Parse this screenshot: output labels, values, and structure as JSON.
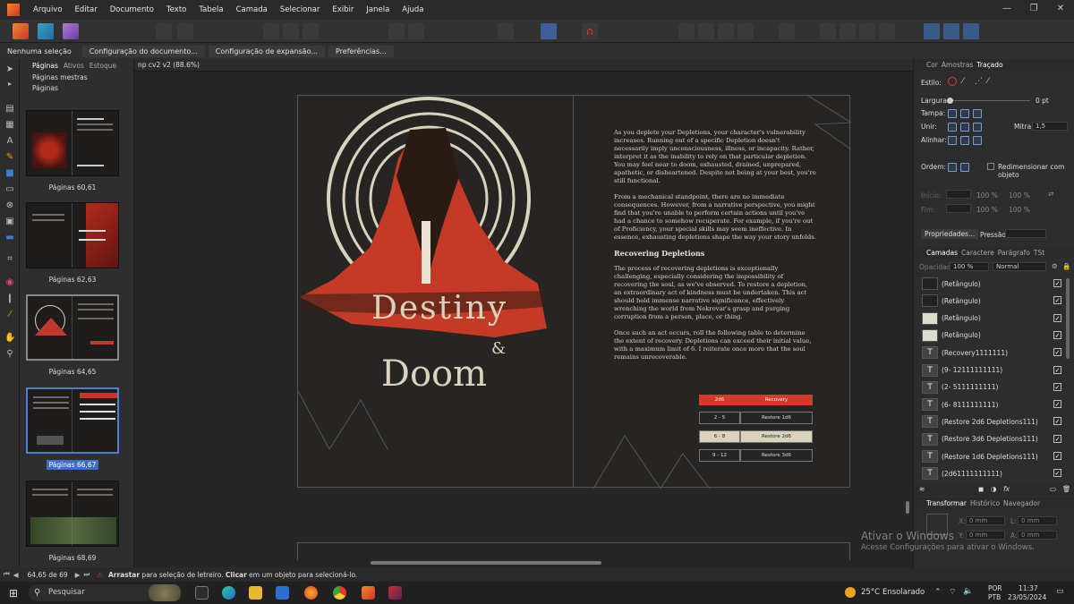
{
  "menu": [
    "Arquivo",
    "Editar",
    "Documento",
    "Texto",
    "Tabela",
    "Camada",
    "Selecionar",
    "Exibir",
    "Janela",
    "Ajuda"
  ],
  "context_bar": {
    "selection": "Nenhuma seleção",
    "doc_setup": "Configuração do documento...",
    "bleed_setup": "Configuração de expansão...",
    "preferences": "Preferências..."
  },
  "pages_panel": {
    "tabs": [
      "Páginas",
      "Ativos",
      "Estoque"
    ],
    "master_pages": "Páginas mestras",
    "pages": "Páginas",
    "thumbnails": [
      {
        "label": "Páginas 60,61"
      },
      {
        "label": "Páginas 62,63"
      },
      {
        "label": "Páginas 64,65"
      },
      {
        "label": "Páginas 66,67"
      },
      {
        "label": "Páginas 68,69"
      }
    ]
  },
  "document": {
    "tab": "np cv2 v2 (88.6%)",
    "title_word1": "Destiny",
    "title_amp": "&",
    "title_word2": "Doom",
    "paragraphs": [
      "As you deplete your Depletions, your character's vulnerability increases. Running out of a specific Depletion doesn't necessarily imply unconsciousness, illness, or incapacity. Rather, interpret it as the inability to rely on that particular depletion. You may feel near to doom, exhausted, drained, unprepared, apathetic, or disheartened. Despite not being at your best, you're still functional.",
      "From a mechanical standpoint, there are no immediate consequences. However, from a narrative perspective, you might find that you're unable to perform certain actions until you've had a chance to somehow recuperate. For example, if you're out of Proficiency, your special skills may seem ineffective. In essence, exhausting depletions shape the way your story unfolds.",
      "The process of recovering depletions is exceptionally challenging, especially considering the impossibility of recovering the soul, as we've observed. To restore a depletion, an extraordinary act of kindness must be undertaken. This act should hold immense narrative significance, effectively wrenching the world from Nekrovar's grasp and purging corruption from a person, place, or thing.",
      "Once such an act occurs, roll the following table to determine the extent of recovery. Depletions can exceed their initial value, with a maximum limit of 6. I reiterate once more that the soul remains unrecoverable."
    ],
    "heading": "Recovering Depletions",
    "table": {
      "headers": [
        "2d6",
        "Recovery"
      ],
      "rows": [
        [
          "2 - 5",
          "Restore 1d6"
        ],
        [
          "6 - 8",
          "Restore 2d6"
        ],
        [
          "9 - 12",
          "Restore 3d6"
        ]
      ]
    }
  },
  "right_panel": {
    "tabs1": [
      "Cor",
      "Amostras",
      "Traçado"
    ],
    "style_label": "Estilo:",
    "width_label": "Largura:",
    "width_value": "0 pt",
    "cap_label": "Tampa:",
    "join_label": "Unir:",
    "miter_label": "Mitra:",
    "miter_value": "1,5",
    "align_label": "Alinhar:",
    "order_label": "Ordem:",
    "resize_label": "Redimensionar com objeto",
    "start_label": "Início:",
    "end_label": "Fim:",
    "start_pct": "100 %",
    "start_pct2": "100 %",
    "end_pct": "100 %",
    "end_pct2": "100 %",
    "properties_btn": "Propriedades...",
    "pressure_label": "Pressão:",
    "tabs2": [
      "Camadas",
      "Caractere",
      "Parágrafo",
      "TSt"
    ],
    "opacity_label": "Opacidade:",
    "opacity_value": "100 %",
    "blend_value": "Normal",
    "layers": [
      {
        "name": "(Retângulo)",
        "thumb": "dark"
      },
      {
        "name": "(Retângulo)",
        "thumb": "dark"
      },
      {
        "name": "(Retângulo)",
        "thumb": "light"
      },
      {
        "name": "(Retângulo)",
        "thumb": "light"
      },
      {
        "name": "(Recovery1111111)",
        "thumb": "txt"
      },
      {
        "name": "(9- 12111111111)",
        "thumb": "txt"
      },
      {
        "name": "(2- 5111111111)",
        "thumb": "txt"
      },
      {
        "name": "(6- 8111111111)",
        "thumb": "txt"
      },
      {
        "name": "(Restore 2d6 Depletions111)",
        "thumb": "txt"
      },
      {
        "name": "(Restore 3d6 Depletions111)",
        "thumb": "txt"
      },
      {
        "name": "(Restore 1d6 Depletions111)",
        "thumb": "txt"
      },
      {
        "name": "(2d61111111111)",
        "thumb": "txt"
      }
    ],
    "tabs3": [
      "Transformar",
      "Histórico",
      "Navegador"
    ],
    "x_value": "0 mm",
    "y_value": "0 mm",
    "w_value": "0 mm",
    "h_value": "0 mm"
  },
  "status": {
    "page_indicator": "64,65 de 69",
    "hint_bold1": "Arrastar",
    "hint1": " para seleção de letreiro. ",
    "hint_bold2": "Clicar",
    "hint2": " em um objeto para selecioná-lo."
  },
  "watermark": {
    "title": "Ativar o Windows",
    "subtitle": "Acesse Configurações para ativar o Windows."
  },
  "taskbar": {
    "search": "Pesquisar",
    "temp": "25°C",
    "weather": "Ensolarado",
    "lang1": "POR",
    "lang2": "PTB",
    "time": "11:37",
    "date": "23/05/2024"
  },
  "colors": {
    "accent": "#d23a2a",
    "selection": "#3d6fc4",
    "cream": "#d9d3bd"
  }
}
